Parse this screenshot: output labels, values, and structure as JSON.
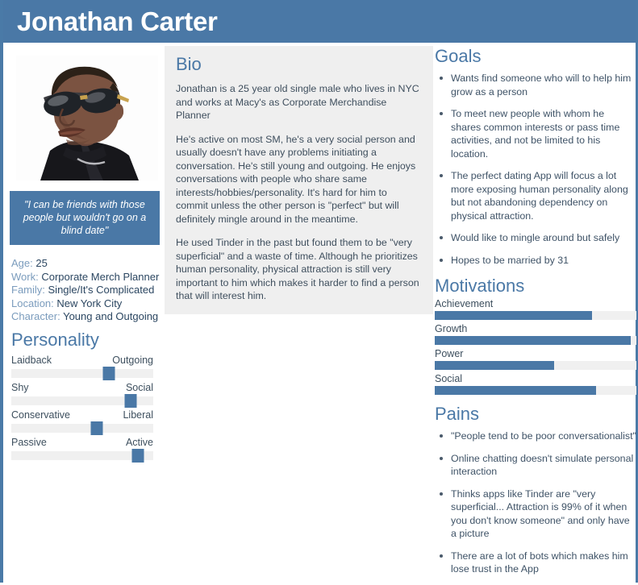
{
  "header": {
    "title": "Jonathan Carter"
  },
  "photo": {
    "alt": "portrait-of-man-wearing-sunglasses"
  },
  "quote": {
    "text": "\"I can be friends with those people but wouldn't go on a blind date\""
  },
  "info": [
    {
      "label": "Age:",
      "value": "25"
    },
    {
      "label": "Work:",
      "value": "Corporate Merch Planner"
    },
    {
      "label": "Family:",
      "value": "Single/It's Complicated"
    },
    {
      "label": "Location:",
      "value": "New York City"
    },
    {
      "label": "Character:",
      "value": "Young and Outgoing"
    }
  ],
  "personality": {
    "heading": "Personality",
    "sliders": [
      {
        "left": "Laidback",
        "right": "Outgoing",
        "value": 69
      },
      {
        "left": "Shy",
        "right": "Social",
        "value": 84
      },
      {
        "left": "Conservative",
        "right": "Liberal",
        "value": 60
      },
      {
        "left": "Passive",
        "right": "Active",
        "value": 89
      }
    ]
  },
  "bio": {
    "heading": "Bio",
    "paragraphs": [
      "Jonathan is a 25 year old single male who lives in NYC and works at Macy's as Corporate Merchandise Planner",
      "He's active on most SM, he's a very social person and usually doesn't have any problems initiating a conversation. He's still young and outgoing. He enjoys conversations with people who share same interests/hobbies/personality. It's hard for him to commit unless the other person is \"perfect\" but will definitely mingle around in the meantime.",
      "He used Tinder in the past but found them to be \"very superficial\" and a waste of time. Although he prioritizes human personality, physical attraction is still very important to him which makes it harder to find a person that will interest him."
    ]
  },
  "goals": {
    "heading": "Goals",
    "items": [
      "Wants find someone who will to help him grow as a person",
      "To meet new people with whom he shares common interests or pass time activities, and not be limited to his location.",
      "The perfect dating App will focus a lot more exposing human personality along but not abandoning dependency on physical attraction.",
      "Would like to mingle around but safely",
      "Hopes to be married by 31"
    ]
  },
  "motivations": {
    "heading": "Motivations",
    "bars": [
      {
        "label": "Achievement",
        "value": 78
      },
      {
        "label": "Growth",
        "value": 97
      },
      {
        "label": "Power",
        "value": 59
      },
      {
        "label": "Social",
        "value": 80
      }
    ]
  },
  "pains": {
    "heading": "Pains",
    "items": [
      "\"People tend to be poor conversationalist\"",
      "Online chatting doesn't simulate personal interaction",
      "Thinks apps like Tinder are \"very superficial... Attraction is 99% of it when you don't know someone\" and only have a picture",
      "There are a lot of bots which makes him lose trust in the App"
    ]
  },
  "chart_data": [
    {
      "type": "bar",
      "title": "Personality",
      "categories": [
        "Laidback / Outgoing",
        "Shy / Social",
        "Conservative / Liberal",
        "Passive / Active"
      ],
      "values": [
        69,
        84,
        60,
        89
      ],
      "xlabel": "",
      "ylabel": "",
      "ylim": [
        0,
        100
      ]
    },
    {
      "type": "bar",
      "title": "Motivations",
      "categories": [
        "Achievement",
        "Growth",
        "Power",
        "Social"
      ],
      "values": [
        78,
        97,
        59,
        80
      ],
      "xlabel": "",
      "ylabel": "",
      "ylim": [
        0,
        100
      ]
    }
  ],
  "colors": {
    "brand_blue": "#4a78a6",
    "panel_gray": "#efefef",
    "track_gray": "#f0f0f0",
    "label_blue": "#7b9cbd",
    "text_navy": "#2b4661"
  }
}
